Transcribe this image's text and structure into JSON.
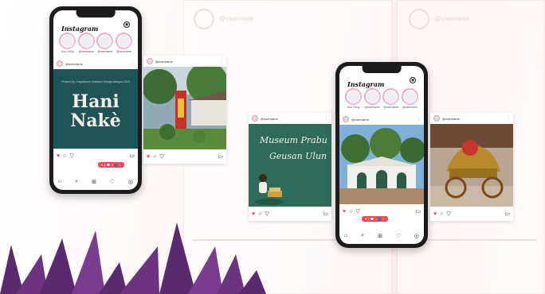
{
  "app": {
    "name": "Instagram"
  },
  "username": "@username",
  "stories": [
    "Your Story",
    "@username",
    "@username",
    "@username"
  ],
  "left_phone": {
    "post_subtitle": "Present by: Gagadanuh Matahari Sahaja Mangsa 2023",
    "post_title_line1": "Hani",
    "post_title_line2": "Nakè"
  },
  "museum_card": {
    "title_line1": "Museum Prabu",
    "title_line2": "Geusan Ulun"
  },
  "notification": "♥ 1  💬 1  👤 1",
  "icons": {
    "heart": "♥",
    "comment": "○",
    "share": "▽",
    "save": "▭",
    "more": "⋮",
    "home": "⌂",
    "search": "⌕",
    "add": "⊞",
    "activity": "♡",
    "profile": "◎",
    "messenger": "◉"
  },
  "colors": {
    "accent": "#ed4956",
    "leaf": "#5a2a6e",
    "teal": "#1e5456"
  }
}
